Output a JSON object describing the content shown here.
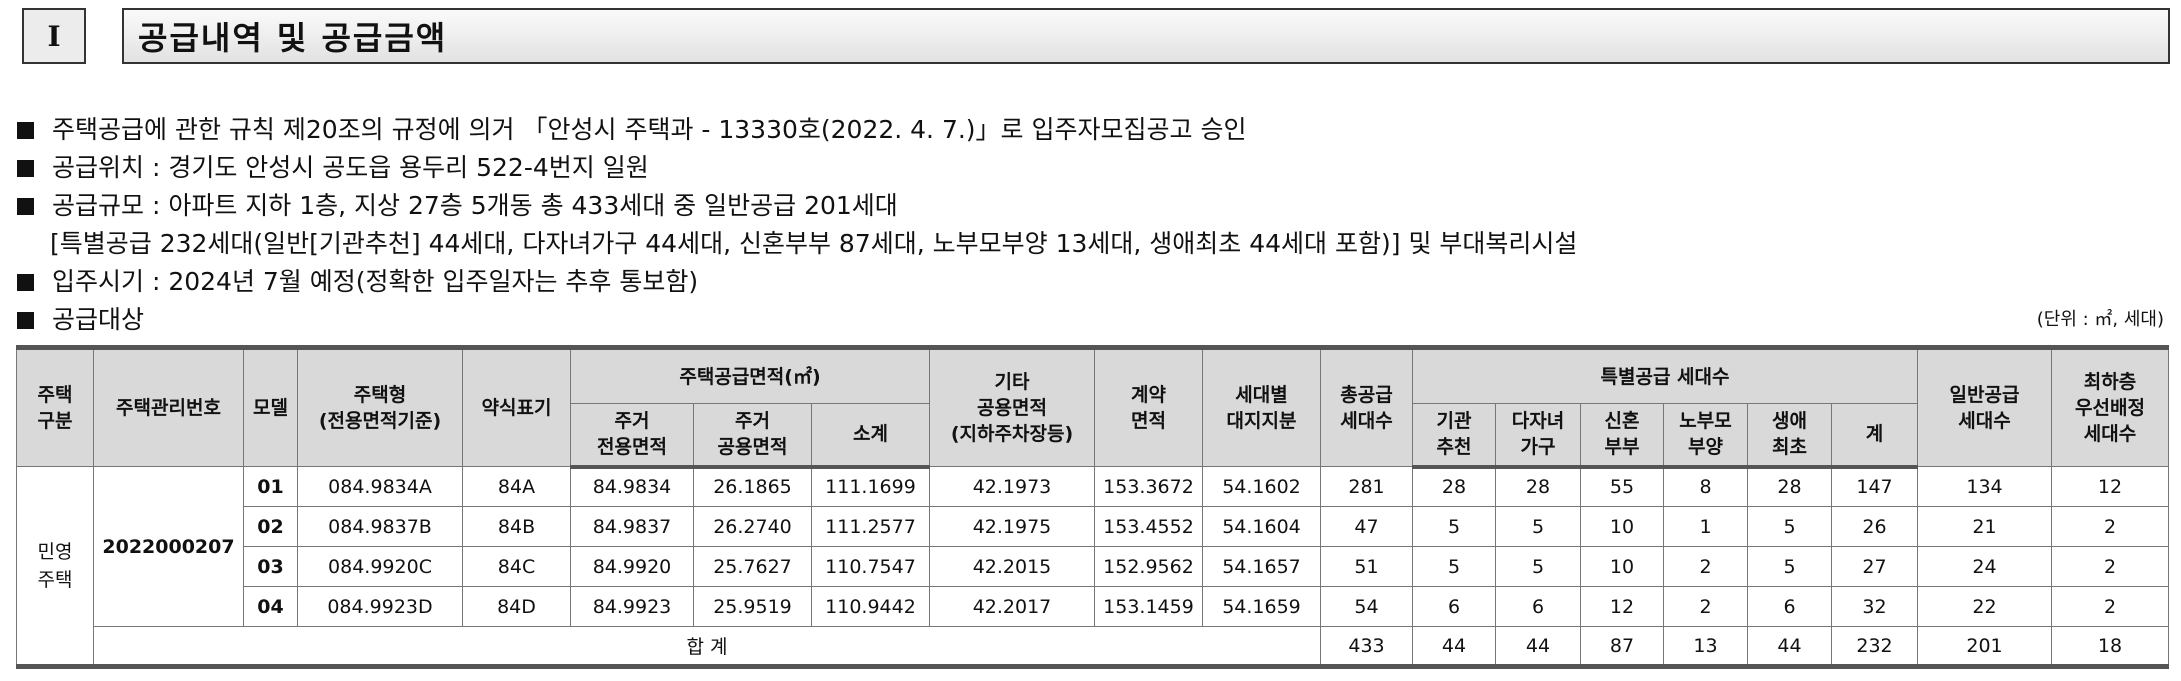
{
  "section": {
    "number": "I",
    "title": "공급내역 및 공급금액"
  },
  "bullets": [
    "주택공급에 관한 규칙 제20조의 규정에 의거 「안성시 주택과 - 13330호(2022. 4. 7.)」로 입주자모집공고 승인",
    "공급위치 : 경기도 안성시 공도읍 용두리 522-4번지 일원",
    "공급규모 : 아파트 지하 1층, 지상 27층 5개동 총 433세대 중 일반공급 201세대"
  ],
  "bullet_indent": "[특별공급 232세대(일반[기관추천] 44세대, 다자녀가구 44세대, 신혼부부 87세대, 노부모부양 13세대, 생애최초 44세대 포함)] 및 부대복리시설",
  "bullets2": [
    "입주시기 : 2024년 7월 예정(정확한 입주일자는 추후 통보함)",
    "공급대상"
  ],
  "unit_note": "(단위 : ㎡, 세대)",
  "table": {
    "headers": {
      "housing_type": "주택\n구분",
      "mgmt_no": "주택관리번호",
      "model": "모델",
      "house_type": "주택형\n(전용면적기준)",
      "abbr": "약식표기",
      "supply_area": "주택공급면적(㎡)",
      "exclusive": "주거\n전용면적",
      "common": "주거\n공용면적",
      "subtotal": "소계",
      "other_common": "기타\n공용면적\n(지하주차장등)",
      "contract_area": "계약\n면적",
      "land_share": "세대별\n대지지분",
      "total_units": "총공급\n세대수",
      "special": "특별공급 세대수",
      "agency": "기관\n추천",
      "multi_child": "다자녀\n가구",
      "newlywed": "신혼\n부부",
      "elderly": "노부모\n부양",
      "first_time": "생애\n최초",
      "special_total": "계",
      "general": "일반공급\n세대수",
      "lowest_floor": "최하층\n우선배정\n세대수"
    },
    "housing_category": "민영\n주택",
    "mgmt_number": "2022000207",
    "rows": [
      {
        "model": "01",
        "house_type": "084.9834A",
        "abbr": "84A",
        "exclusive": "84.9834",
        "common": "26.1865",
        "subtotal": "111.1699",
        "other": "42.1973",
        "contract": "153.3672",
        "land": "54.1602",
        "total": "281",
        "agency": "28",
        "multi": "28",
        "newlywed": "55",
        "elderly": "8",
        "first": "28",
        "sp_total": "147",
        "general": "134",
        "lowest": "12"
      },
      {
        "model": "02",
        "house_type": "084.9837B",
        "abbr": "84B",
        "exclusive": "84.9837",
        "common": "26.2740",
        "subtotal": "111.2577",
        "other": "42.1975",
        "contract": "153.4552",
        "land": "54.1604",
        "total": "47",
        "agency": "5",
        "multi": "5",
        "newlywed": "10",
        "elderly": "1",
        "first": "5",
        "sp_total": "26",
        "general": "21",
        "lowest": "2"
      },
      {
        "model": "03",
        "house_type": "084.9920C",
        "abbr": "84C",
        "exclusive": "84.9920",
        "common": "25.7627",
        "subtotal": "110.7547",
        "other": "42.2015",
        "contract": "152.9562",
        "land": "54.1657",
        "total": "51",
        "agency": "5",
        "multi": "5",
        "newlywed": "10",
        "elderly": "2",
        "first": "5",
        "sp_total": "27",
        "general": "24",
        "lowest": "2"
      },
      {
        "model": "04",
        "house_type": "084.9923D",
        "abbr": "84D",
        "exclusive": "84.9923",
        "common": "25.9519",
        "subtotal": "110.9442",
        "other": "42.2017",
        "contract": "153.1459",
        "land": "54.1659",
        "total": "54",
        "agency": "6",
        "multi": "6",
        "newlywed": "12",
        "elderly": "2",
        "first": "6",
        "sp_total": "32",
        "general": "22",
        "lowest": "2"
      }
    ],
    "total_row": {
      "label": "합 계",
      "total": "433",
      "agency": "44",
      "multi": "44",
      "newlywed": "87",
      "elderly": "13",
      "first": "44",
      "sp_total": "232",
      "general": "201",
      "lowest": "18"
    }
  }
}
